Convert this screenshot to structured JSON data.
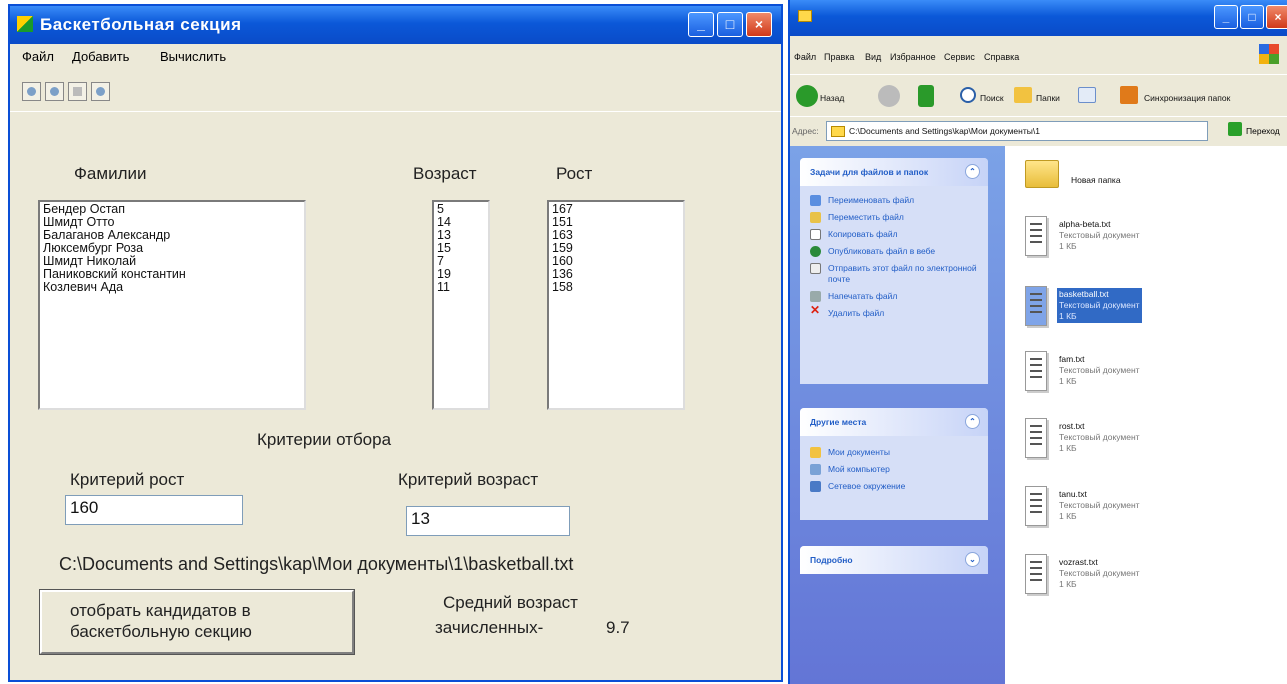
{
  "app": {
    "title": "Баскетбольная секция",
    "menu": [
      "Файл",
      "Добавить",
      "Вычислить"
    ],
    "toolbar_icons": [
      "open-icon",
      "save-icon",
      "table-icon",
      "help-icon"
    ],
    "labels": {
      "surnames": "Фамилии",
      "age": "Возраст",
      "height": "Рост",
      "criteria_title": "Критерии отбора",
      "height_criterion": "Критерий рост",
      "age_criterion": "Критерий возраст"
    },
    "surnames": [
      "Бендер Остап",
      "Шмидт Отто",
      "Балаганов Александр",
      "Люксембург Роза",
      "Шмидт Николай",
      "Паниковский константин",
      "Козлевич Ада"
    ],
    "ages": [
      "5",
      "14",
      "13",
      "15",
      "7",
      "19",
      "11"
    ],
    "heights": [
      "167",
      "151",
      "163",
      "159",
      "160",
      "136",
      "158"
    ],
    "height_value": "160",
    "age_value": "13",
    "file_path": "C:\\Documents and Settings\\kap\\Мои документы\\1\\basketball.txt",
    "select_button": "отобрать кандидатов в баскетбольную секцию",
    "avg_label_1": "Средний возраст",
    "avg_label_2": "зачисленных-",
    "avg_value": "9.7"
  },
  "explorer": {
    "menu": [
      "Файл",
      "Правка",
      "Вид",
      "Избранное",
      "Сервис",
      "Справка"
    ],
    "nav": {
      "back": "Назад",
      "search": "Поиск",
      "folders": "Папки",
      "sync": "Синхронизация папок"
    },
    "address_label": "Адрес:",
    "address": "C:\\Documents and Settings\\kap\\Мои документы\\1",
    "go": "Переход",
    "tasks_title": "Задачи для файлов и папок",
    "tasks": [
      "Переименовать файл",
      "Переместить файл",
      "Копировать файл",
      "Опубликовать файл в вебе",
      "Отправить этот файл по электронной почте",
      "Напечатать файл",
      "Удалить файл"
    ],
    "places_title": "Другие места",
    "places": [
      "Мои документы",
      "Мой компьютер",
      "Сетевое окружение"
    ],
    "details_title": "Подробно",
    "new_folder": "Новая папка",
    "files": [
      {
        "name": "alpha-beta.txt",
        "type": "Текстовый документ",
        "size": "1 КБ"
      },
      {
        "name": "basketball.txt",
        "type": "Текстовый документ",
        "size": "1 КБ"
      },
      {
        "name": "fam.txt",
        "type": "Текстовый документ",
        "size": "1 КБ"
      },
      {
        "name": "rost.txt",
        "type": "Текстовый документ",
        "size": "1 КБ"
      },
      {
        "name": "tanu.txt",
        "type": "Текстовый документ",
        "size": "1 КБ"
      },
      {
        "name": "vozrast.txt",
        "type": "Текстовый документ",
        "size": "1 КБ"
      }
    ]
  }
}
